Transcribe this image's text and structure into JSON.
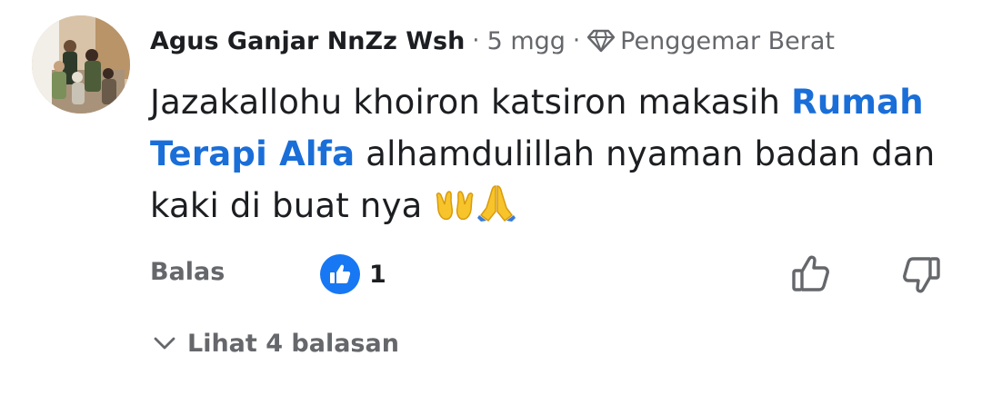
{
  "comment": {
    "author": "Agus Ganjar NnZz Wsh",
    "separator": "·",
    "time": "5 mgg",
    "badge_icon": "diamond-icon",
    "badge_label": "Penggemar Berat",
    "text_part1": "Jazakallohu khoiron katsiron makasih",
    "mention": "Rumah Terapi Alfa",
    "text_part2": "alhamdulillah nyaman badan dan kaki di buat nya",
    "emojis": [
      "open-hands-emoji",
      "folded-hands-emoji"
    ]
  },
  "actions": {
    "reply_label": "Balas",
    "reaction_icon": "thumbs-up-reaction-icon",
    "reaction_count": "1",
    "upvote_icon": "thumbs-up-outline-icon",
    "downvote_icon": "thumbs-down-outline-icon"
  },
  "replies": {
    "icon": "chevron-down-icon",
    "label": "Lihat 4 balasan"
  },
  "colors": {
    "mention": "#1a6ed8",
    "reaction_bubble": "#1877f2",
    "secondary_text": "#65676b",
    "primary_text": "#1c1e21"
  }
}
